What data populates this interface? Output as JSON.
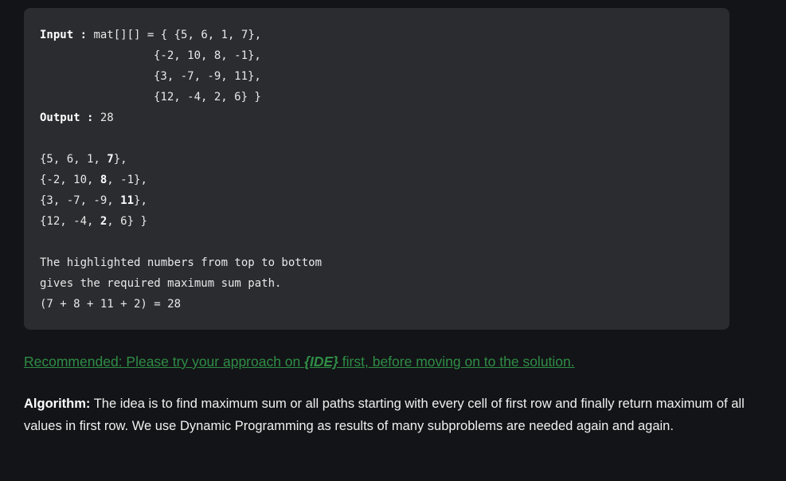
{
  "code_block": {
    "input_label": "Input",
    "input_sep": " : ",
    "input_rows": [
      "mat[][] = { {5, 6, 1, 7},",
      "{-2, 10, 8, -1},",
      "{3, -7, -9, 11},",
      "{12, -4, 2, 6} }"
    ],
    "output_label": "Output",
    "output_sep": " : ",
    "output_value": "28",
    "matrix_rows": [
      {
        "pre": "{5, 6, 1, ",
        "bold": "7",
        "post": "},"
      },
      {
        "pre": "{-2, 10, ",
        "bold": "8",
        "post": ", -1},"
      },
      {
        "pre": "{3, -7, -9, ",
        "bold": "11",
        "post": "},"
      },
      {
        "pre": "{12, -4, ",
        "bold": "2",
        "post": ", 6} }"
      }
    ],
    "explanation": [
      "The highlighted numbers from top to bottom",
      "gives the required maximum sum path.",
      "(7 + 8 + 11 + 2) = 28"
    ]
  },
  "recommended": {
    "prefix": "Recommended: Please try your approach on ",
    "ide": "{IDE}",
    "suffix": " first, before moving on to the solution."
  },
  "algorithm": {
    "label": "Algorithm:",
    "text": " The idea is to find maximum sum or all paths starting with every cell of first row and finally return maximum of all values in first row. We use Dynamic Programming as results of many subproblems are needed again and again."
  },
  "colors": {
    "background": "#131417",
    "code_background": "#2a2c30",
    "link": "#2f8d46"
  }
}
